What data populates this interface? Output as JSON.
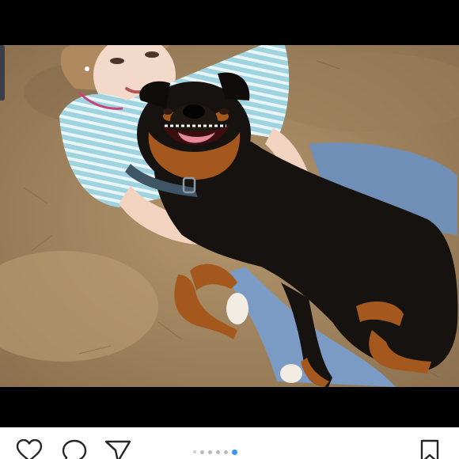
{
  "post": {
    "photo_alt": "",
    "carousel": {
      "count": 6,
      "active_index": 5
    },
    "actions": {
      "like_icon": "heart-icon",
      "comment_icon": "comment-icon",
      "share_icon": "paper-plane-icon",
      "save_icon": "bookmark-icon"
    }
  },
  "colors": {
    "letterbox": "#000000",
    "background": "#ffffff",
    "icon": "#262626",
    "active_dot": "#3897f0",
    "inactive_dot": "#b9b9b9"
  }
}
